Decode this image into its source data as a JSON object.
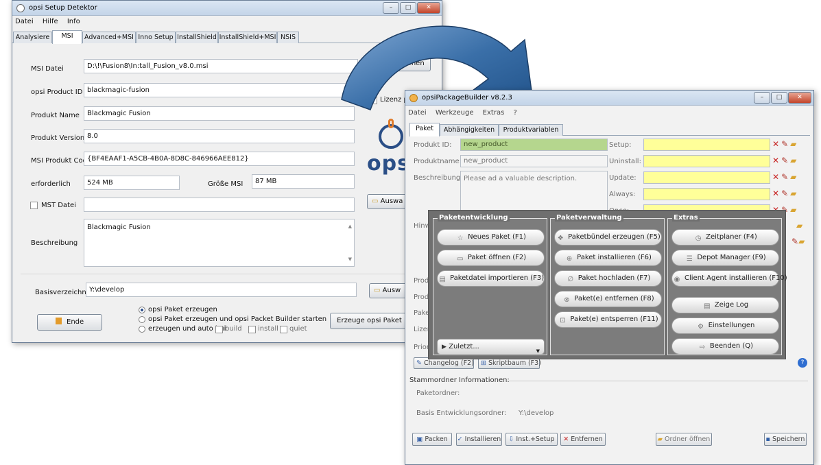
{
  "detektor": {
    "title": "opsi Setup Detektor",
    "menu": [
      "Datei",
      "Hilfe",
      "Info"
    ],
    "tabs": [
      "Analysiere",
      "MSI",
      "Advanced+MSI",
      "Inno Setup",
      "InstallShield",
      "InstallShield+MSI",
      "NSIS"
    ],
    "active_tab": "MSI",
    "fields": {
      "msi_datei_label": "MSI Datei",
      "msi_datei_value": "D:\\!\\Fusion8\\In:tall_Fusion_v8.0.msi",
      "product_id_label": "opsi Product ID",
      "product_id_value": "blackmagic-fusion",
      "produkt_name_label": "Produkt Name",
      "produkt_name_value": "Blackmagic Fusion",
      "produkt_version_label": "Produkt Version",
      "produkt_version_value": "8.0",
      "msi_code_label": "MSI Produkt Code",
      "msi_code_value": "{BF4EAAF1-A5CB-4B0A-8D8C-846966AEE812}",
      "erforderlich_label": "erforderlich",
      "erforderlich_value": "524 MB",
      "groesse_label": "Größe MSI",
      "groesse_value": "87 MB",
      "mst_label": "MST Datei",
      "mst_value": "",
      "beschreibung_label": "Beschreibung",
      "beschreibung_value": "Blackmagic Fusion",
      "basis_label": "Basisverzeichnis",
      "basis_value": "Y:\\develop"
    },
    "buttons": {
      "datei_oeffnen": "Datei öffnen",
      "lizenz": "Lizenz p",
      "auswahl1": "Auswa",
      "auswahl2": "Ausw",
      "ende": "Ende",
      "erzeuge": "Erzeuge opsi Paket"
    },
    "logo_text": "ops",
    "options": {
      "r1": "opsi Paket erzeugen",
      "r2": "opsi Paket erzeugen und opsi Packet Builder starten",
      "r3": "erzeugen und auto bui",
      "c_build": "build",
      "c_install": "install",
      "c_quiet": "quiet"
    }
  },
  "builder": {
    "title": "opsiPackageBuilder v8.2.3",
    "menu": [
      "Datei",
      "Werkzeuge",
      "Extras",
      "?"
    ],
    "tabs": [
      "Paket",
      "Abhängigkeiten",
      "Produktvariablen"
    ],
    "left": {
      "produkt_id_label": "Produkt ID:",
      "produkt_id_value": "new_product",
      "produktname_label": "Produktname:",
      "produktname_value": "new_product",
      "beschreibung_label": "Beschreibung:",
      "beschreibung_value": "Please ad a valuable description.",
      "hinweis_label": "Hinwe",
      "produ1": "Produ",
      "produ2": "Produ",
      "paket": "Paket",
      "lizenz": "Lizenz",
      "priorit": "Priorit"
    },
    "right": {
      "setup": "Setup:",
      "uninstall": "Uninstall:",
      "update": "Update:",
      "always": "Always:",
      "once": "Once:"
    },
    "changelog": "Changelog (F2)",
    "skriptbaum": "Skriptbaum (F3)",
    "stamm": {
      "header": "Stammordner Informationen:",
      "paketordner_label": "Paketordner:",
      "basis_label": "Basis Entwicklungsordner:",
      "basis_value": "Y:\\develop"
    },
    "bottom": {
      "packen": "Packen",
      "installieren": "Installieren",
      "inst_setup": "Inst.+Setup",
      "entfernen": "Entfernen",
      "ordner": "Ordner öffnen",
      "speichern": "Speichern"
    },
    "popup": {
      "entwicklung": {
        "header": "Paketentwicklung",
        "items": [
          "Neues Paket (F1)",
          "Paket öffnen (F2)",
          "Paketdatei importieren (F3)"
        ],
        "zuletzt": "Zuletzt..."
      },
      "verwaltung": {
        "header": "Paketverwaltung",
        "items": [
          "Paketbündel erzeugen (F5)",
          "Paket installieren (F6)",
          "Paket hochladen (F7)",
          "Paket(e) entfernen (F8)",
          "Paket(e) entsperren (F11)"
        ]
      },
      "extras": {
        "header": "Extras",
        "items": [
          "Zeitplaner (F4)",
          "Depot Manager (F9)",
          "Client Agent installieren (F10)",
          "Zeige Log",
          "Einstellungen",
          "Beenden (Q)"
        ]
      }
    }
  },
  "colors": {
    "arrow_blue": "#3a6fa8",
    "field_yellow": "#ffff99",
    "field_green": "#b5d68e",
    "popup_grey": "#6f6f6f",
    "logo_blue": "#2b4f87",
    "logo_orange": "#e07b2a"
  }
}
